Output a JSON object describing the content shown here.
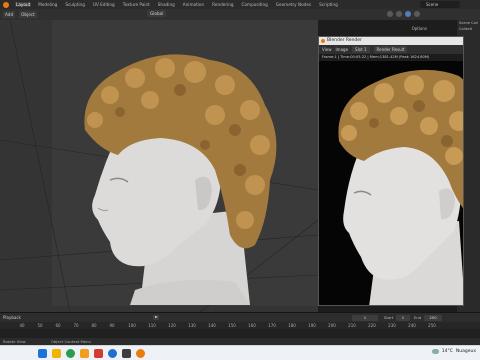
{
  "topbar": {
    "tabs": [
      "Layout",
      "Modeling",
      "Sculpting",
      "UV Editing",
      "Texture Paint",
      "Shading",
      "Animation",
      "Rendering",
      "Compositing",
      "Geometry Nodes",
      "Scripting"
    ],
    "scene": "Scene"
  },
  "header": {
    "add_label": "Add",
    "object_label": "Object",
    "orientation": "Global",
    "options_label": "Options"
  },
  "render_window": {
    "title": "Blender Render",
    "menu": [
      "View",
      "Image",
      "Slot 1",
      "Render Result"
    ],
    "stats": "Frame:1 | Time:00:05.22 | Mem:1381.42M (Peak 1624.80M)"
  },
  "right_panel": {
    "rows": [
      "Scene Coll",
      "Collecti"
    ]
  },
  "timeline": {
    "playback_label": "Playback",
    "current_frame": "1",
    "start_label": "Start",
    "start_value": "1",
    "end_label": "End",
    "end_value": "250",
    "ticks": [
      "40",
      "50",
      "60",
      "70",
      "80",
      "90",
      "100",
      "110",
      "120",
      "130",
      "140",
      "150",
      "160",
      "170",
      "180",
      "190",
      "200",
      "210",
      "220",
      "230",
      "240",
      "250"
    ]
  },
  "statusbar": {
    "left": "Rotate View",
    "middle": "Object Context Menu"
  },
  "taskbar": {
    "temperature": "14°C",
    "weather": "Nuageux"
  },
  "colors": {
    "accent": "#4a78b8",
    "blender_orange": "#e87d0d",
    "skin": "#d9d8d6",
    "hair": "#a37a3e"
  }
}
